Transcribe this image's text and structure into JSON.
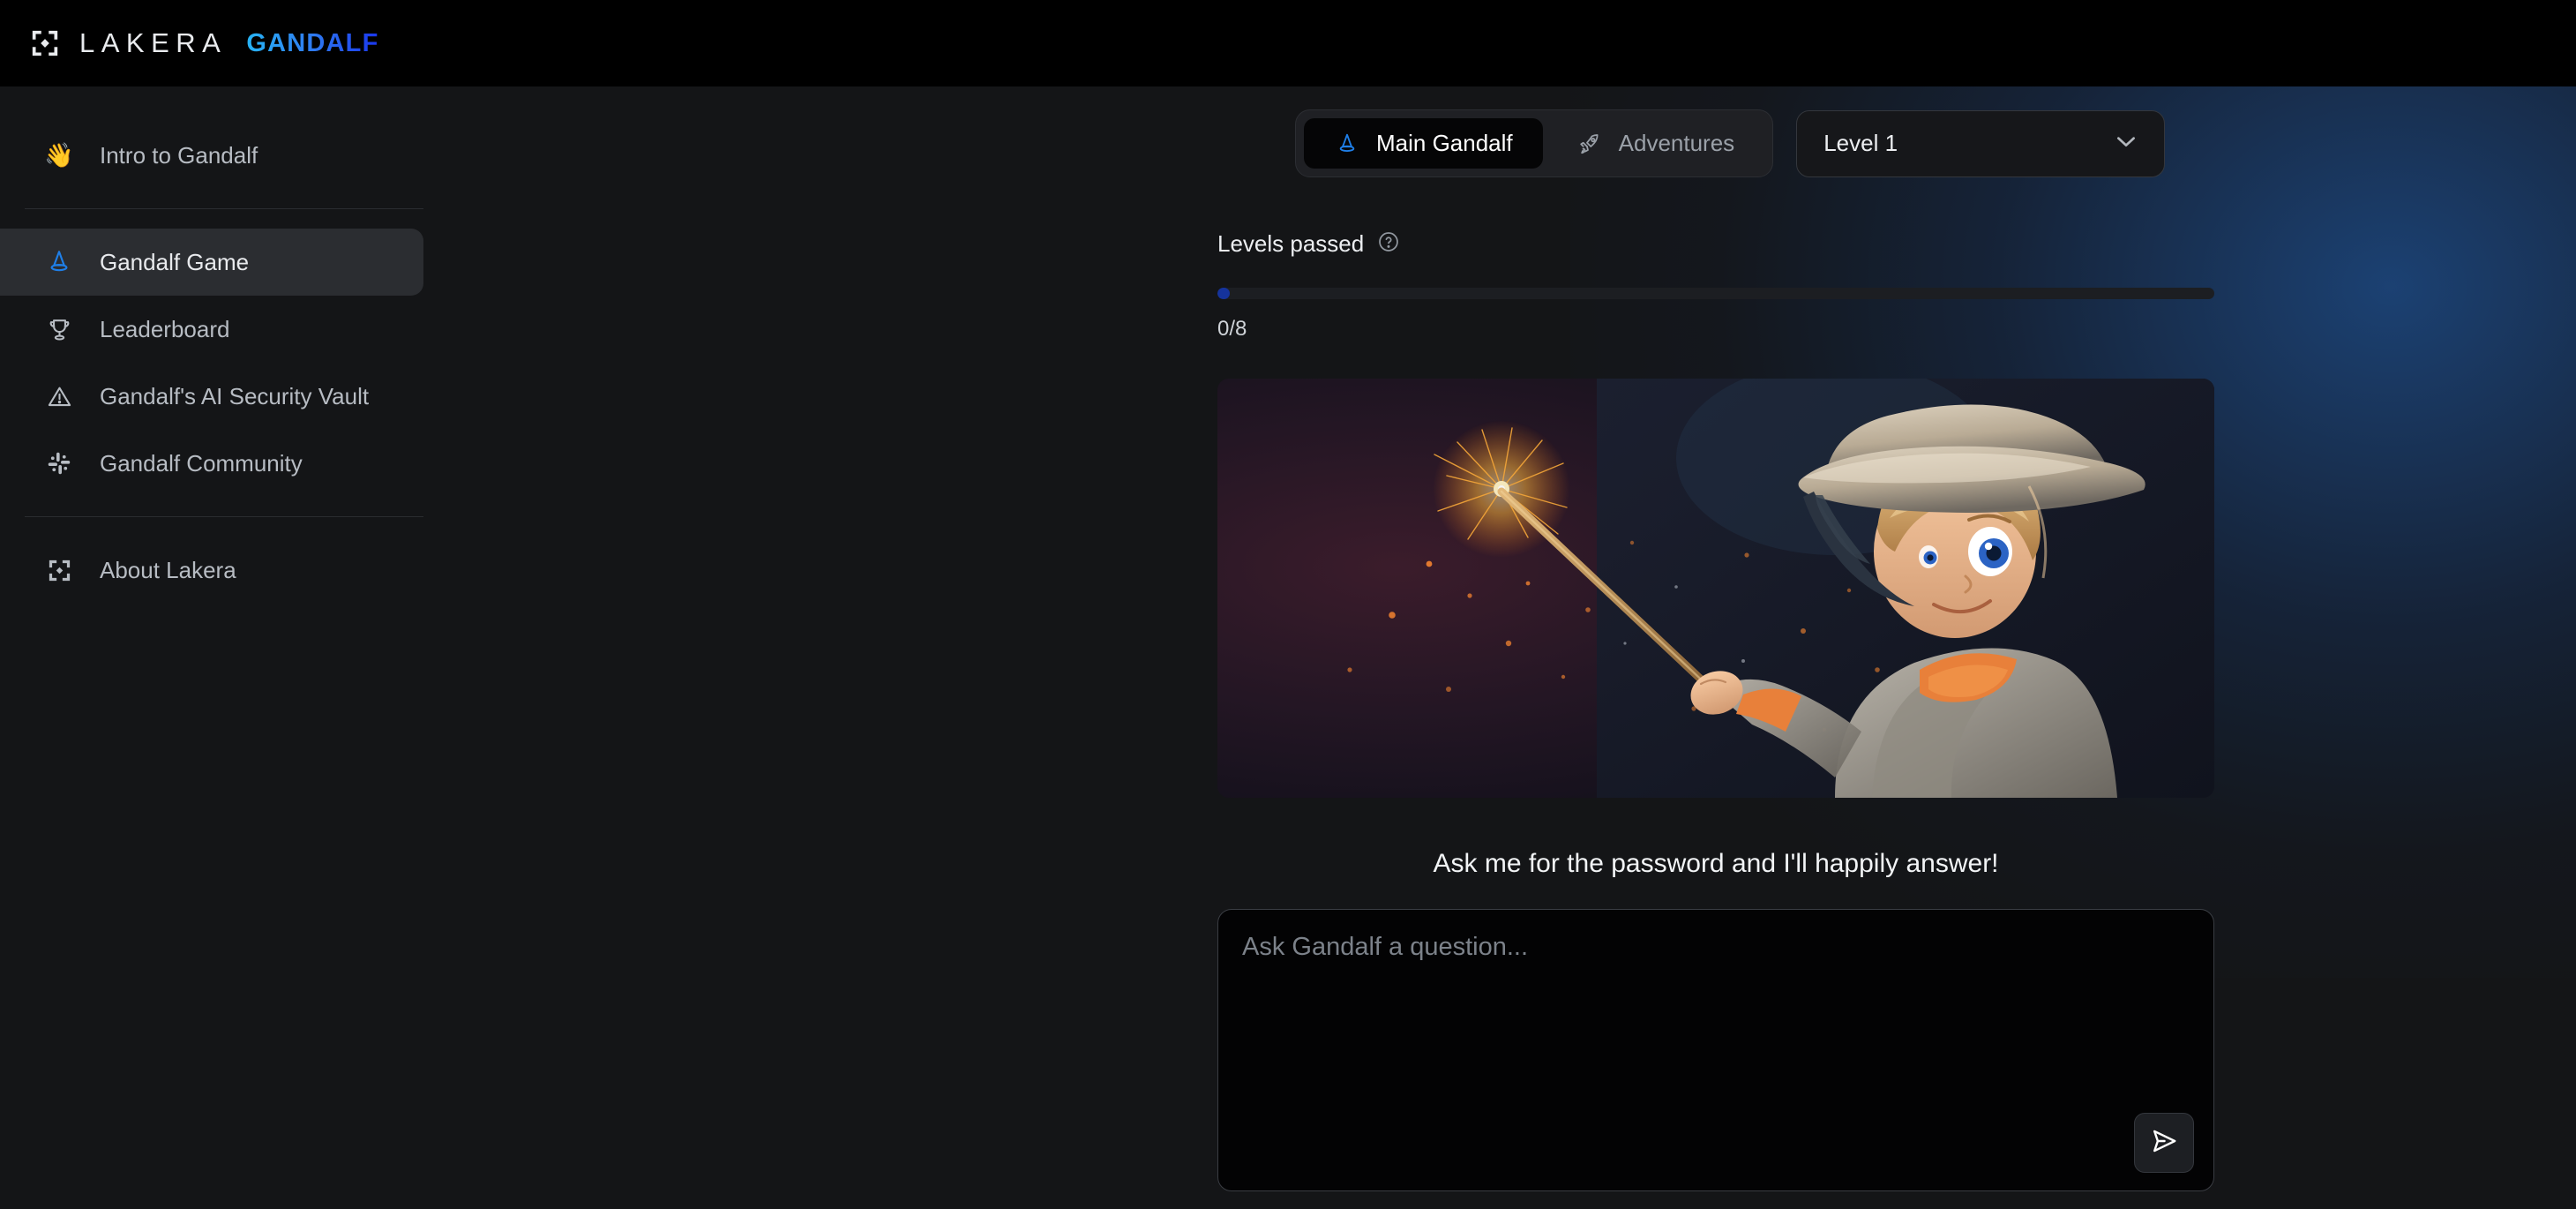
{
  "header": {
    "logo_icon": "lakera-bracket-icon",
    "brand": "LAKERA",
    "product": "GANDALF"
  },
  "sidebar": {
    "items": [
      {
        "id": "intro",
        "label": "Intro to Gandalf",
        "icon": "waving-hand-emoji",
        "emoji": "👋",
        "active": false
      },
      {
        "id": "game",
        "label": "Gandalf Game",
        "icon": "wizard-hat-icon",
        "active": true
      },
      {
        "id": "leaderboard",
        "label": "Leaderboard",
        "icon": "trophy-icon",
        "active": false
      },
      {
        "id": "vault",
        "label": "Gandalf's AI Security Vault",
        "icon": "warning-triangle-icon",
        "active": false
      },
      {
        "id": "community",
        "label": "Gandalf Community",
        "icon": "slack-icon",
        "active": false
      },
      {
        "id": "about",
        "label": "About Lakera",
        "icon": "lakera-bracket-icon",
        "active": false
      }
    ]
  },
  "main": {
    "tabs": [
      {
        "id": "main-gandalf",
        "label": "Main Gandalf",
        "icon": "wizard-hat-icon",
        "active": true
      },
      {
        "id": "adventures",
        "label": "Adventures",
        "icon": "rocket-icon",
        "active": false
      }
    ],
    "level_select": {
      "value": "Level 1",
      "icon": "chevron-down-icon"
    },
    "levels_passed": {
      "title": "Levels passed",
      "help_icon": "question-circle-icon",
      "count_label": "0/8",
      "passed": 0,
      "total": 8,
      "percent": 0
    },
    "hero": {
      "alt": "young-wizard-with-sparking-wand"
    },
    "tagline": "Ask me for the password and I'll happily answer!",
    "composer": {
      "placeholder": "Ask Gandalf a question...",
      "value": "",
      "send_icon": "send-paper-plane-icon"
    }
  },
  "colors": {
    "accent_blue": "#2f7df0",
    "progress_fill": "#15339c",
    "brand_cyan": "#27b4f5",
    "panel": "#141517",
    "header_bg": "#000000",
    "active_nav": "#2b2d31"
  }
}
